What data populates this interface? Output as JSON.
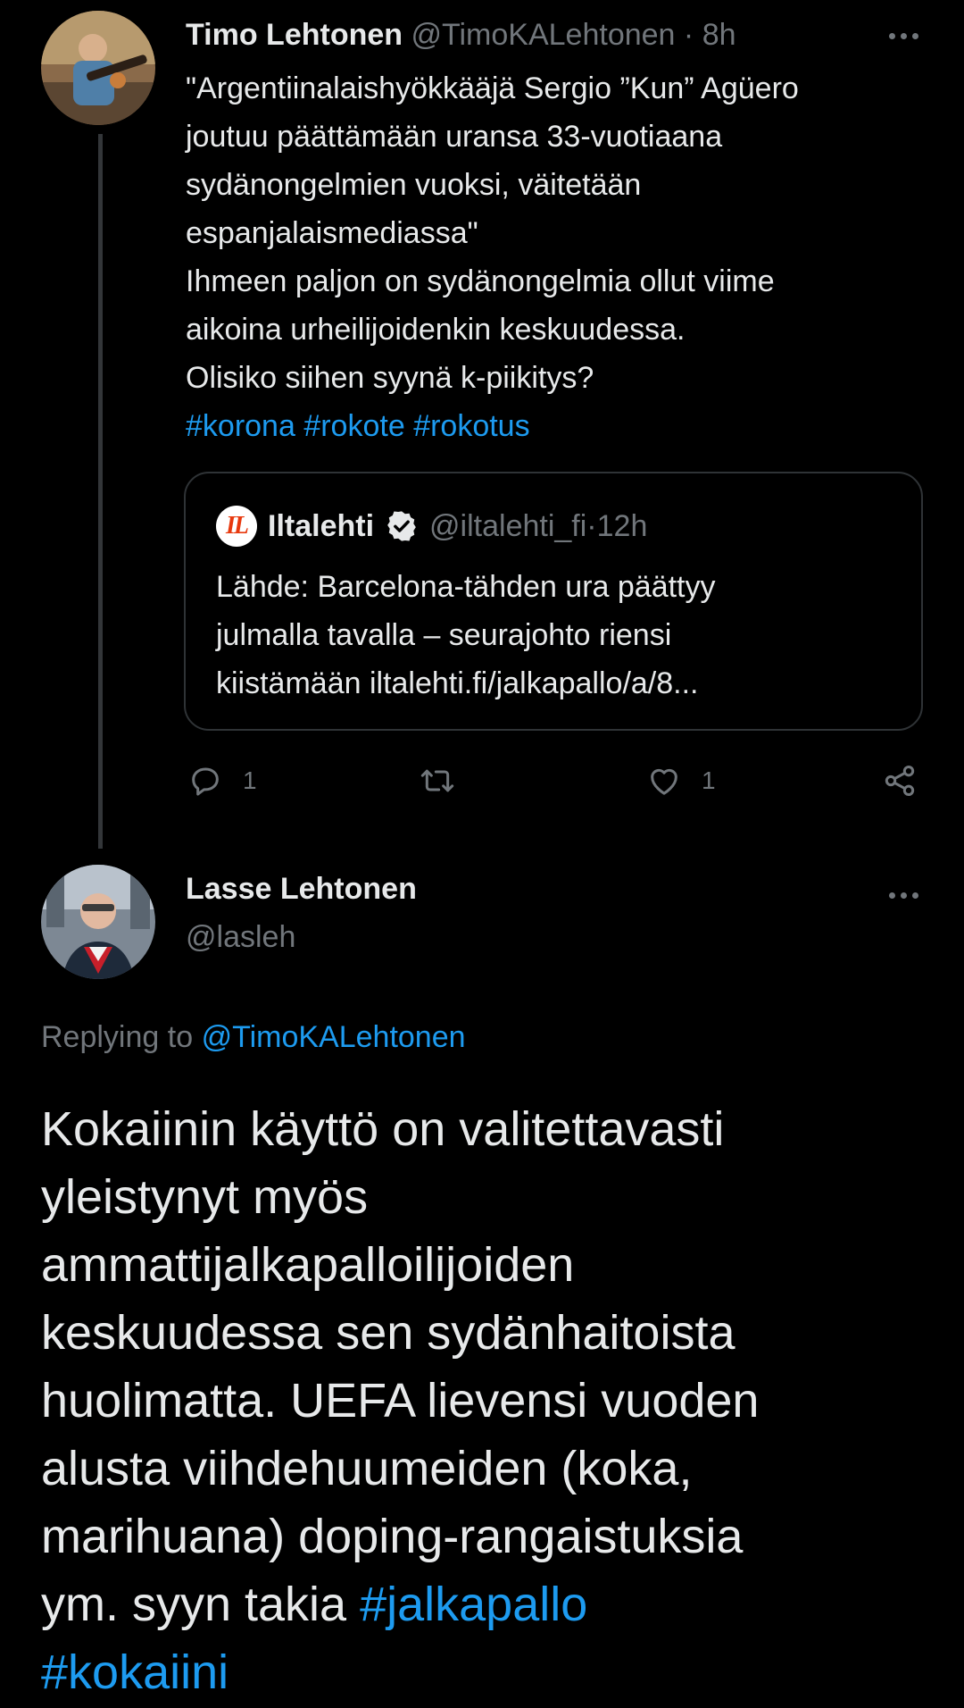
{
  "tweet1": {
    "author_name": "Timo Lehtonen",
    "author_handle": "@TimoKALehtonen",
    "separator": " · ",
    "time": "8h",
    "body_lines": [
      "\"Argentiinalaishyökkääjä Sergio ”Kun” Agüero",
      "joutuu päättämään uransa 33-vuotiaana",
      "sydänongelmien vuoksi, väitetään",
      "espanjalaismediassa\"",
      "Ihmeen paljon on sydänongelmia ollut viime",
      "aikoina urheilijoidenkin keskuudessa.",
      "Olisiko siihen syynä k-piikitys?"
    ],
    "hashtags": [
      "#korona",
      "#rokote",
      "#rokotus"
    ],
    "quote": {
      "logo_text": "IL",
      "author_name": "Iltalehti",
      "author_handle": "@iltalehti_fi",
      "separator": " · ",
      "time": "12h",
      "body_lines": [
        "Lähde: Barcelona-tähden ura päättyy",
        "julmalla tavalla – seurajohto riensi",
        "kiistämään iltalehti.fi/jalkapallo/a/8..."
      ]
    },
    "actions": {
      "reply_count": "1",
      "retweet_count": "",
      "like_count": "1"
    }
  },
  "tweet2": {
    "author_name": "Lasse Lehtonen",
    "author_handle": "@lasleh",
    "replying_label": "Replying to",
    "replying_to": "@TimoKALehtonen",
    "body_lines": [
      "Kokaiinin käyttö on valitettavasti",
      "yleistynyt myös",
      "ammattijalkapalloilijoiden",
      "keskuudessa sen sydänhaitoista",
      "huolimatta. UEFA lievensi vuoden",
      "alusta viihdehuumeiden (koka,",
      "marihuana) doping-rangaistuksia",
      "ym. syyn takia "
    ],
    "hashtags": [
      "#jalkapallo",
      "#kokaiini"
    ]
  },
  "colors": {
    "background": "#000000",
    "text": "#e7e9ea",
    "muted": "#71767b",
    "link": "#1d9bf0",
    "border": "#2f3336"
  }
}
